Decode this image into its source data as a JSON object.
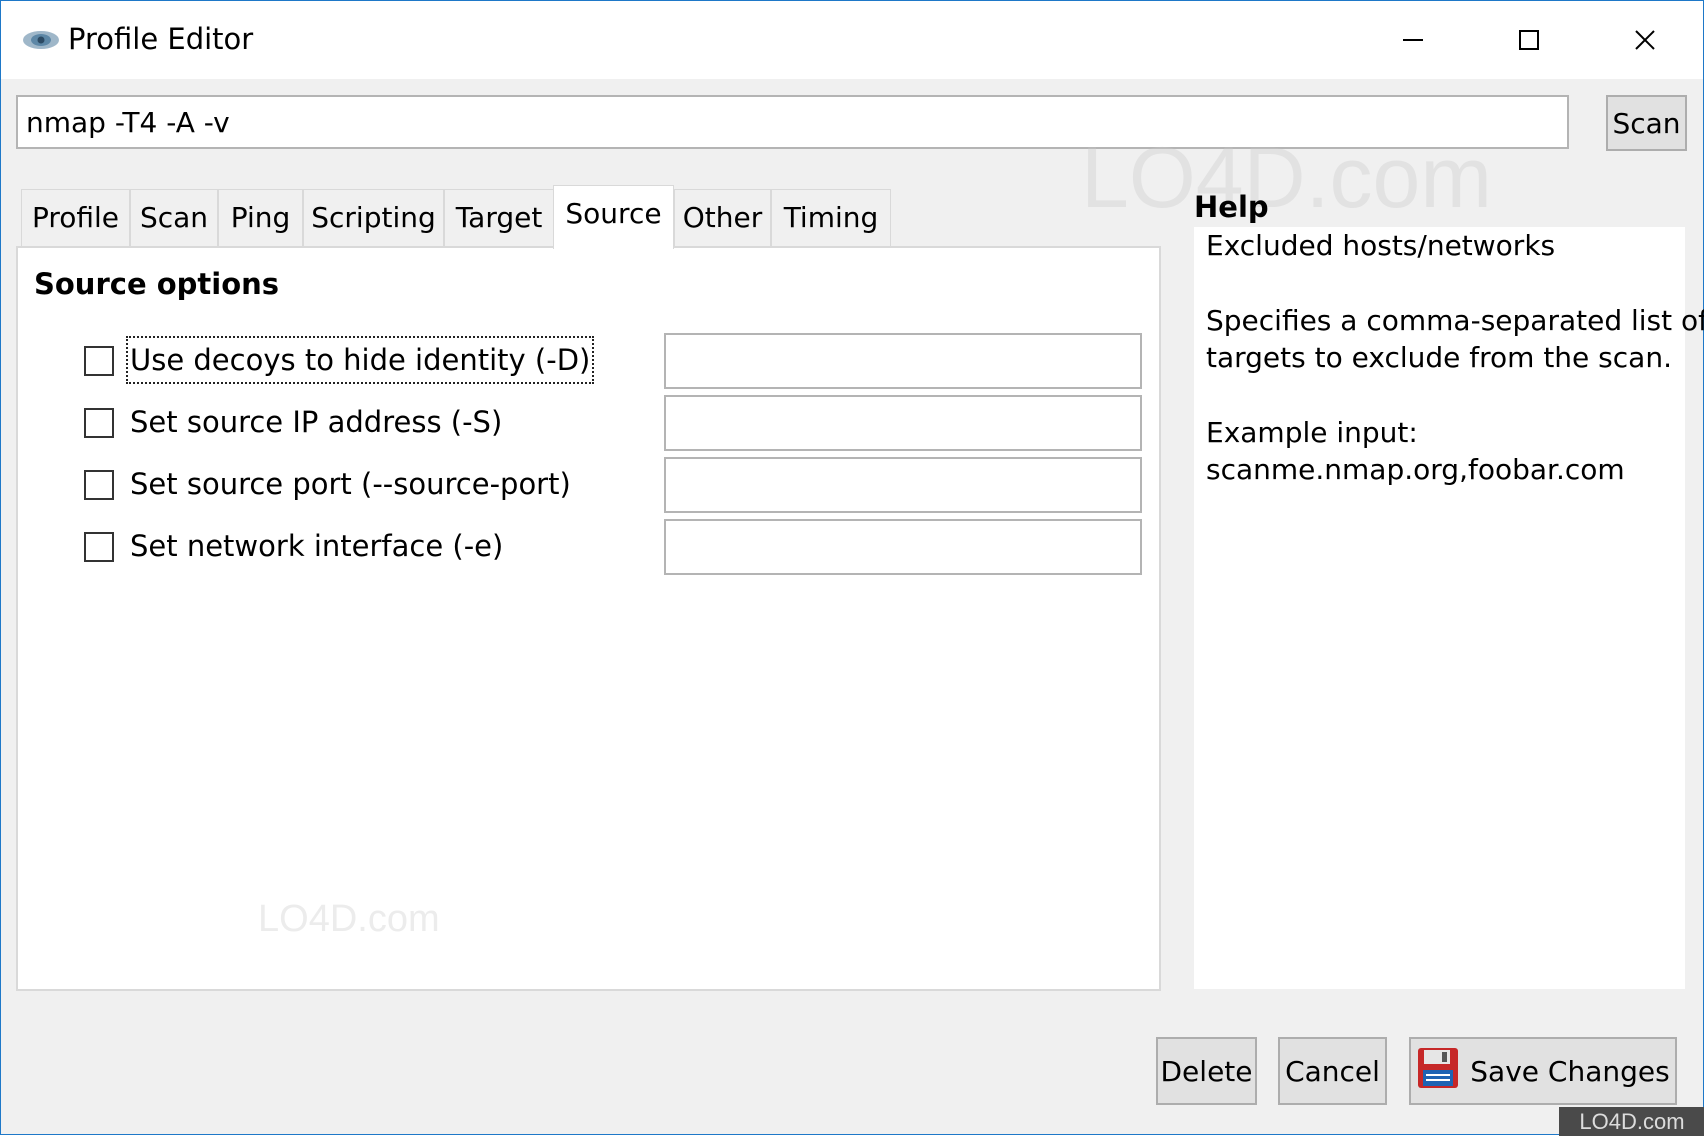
{
  "window": {
    "title": "Profile Editor",
    "icon": "eye-icon"
  },
  "title_buttons": {
    "minimize": "minimize-icon",
    "maximize": "maximize-icon",
    "close": "close-icon"
  },
  "command": {
    "value": "nmap -T4 -A -v",
    "scan_label": "Scan"
  },
  "tabs": [
    {
      "label": "Profile"
    },
    {
      "label": "Scan"
    },
    {
      "label": "Ping"
    },
    {
      "label": "Scripting"
    },
    {
      "label": "Target"
    },
    {
      "label": "Source",
      "active": true
    },
    {
      "label": "Other"
    },
    {
      "label": "Timing"
    }
  ],
  "panel": {
    "title": "Source options",
    "options": [
      {
        "label": "Use decoys to hide identity (-D)",
        "checked": false,
        "value": ""
      },
      {
        "label": "Set source IP address (-S)",
        "checked": false,
        "value": ""
      },
      {
        "label": "Set source port (--source-port)",
        "checked": false,
        "value": ""
      },
      {
        "label": "Set network interface (-e)",
        "checked": false,
        "value": ""
      }
    ]
  },
  "help": {
    "title": "Help",
    "heading": "Excluded hosts/networks",
    "line1": "Specifies a comma-separated list of",
    "line2": "targets to exclude from the scan.",
    "example_label": "Example input:",
    "example_value": "scanme.nmap.org,foobar.com"
  },
  "buttons": {
    "delete": "Delete",
    "cancel": "Cancel",
    "save": "Save Changes",
    "save_icon": "floppy-disk-icon"
  },
  "watermark": {
    "large": "LO4D.com",
    "small": "LO4D.com",
    "corner": "LO4D.com"
  }
}
